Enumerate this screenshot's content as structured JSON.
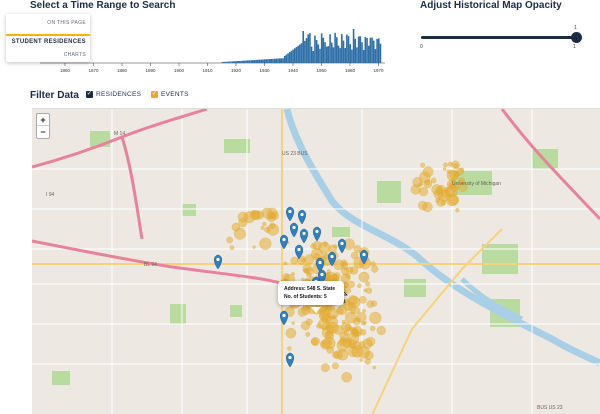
{
  "header": {
    "time_title": "Select a Time Range to Search",
    "opacity_title": "Adjust Historical Map Opacity"
  },
  "nav": {
    "items": [
      {
        "label": "ON THIS PAGE"
      },
      {
        "label": "STUDENT RESIDENCES"
      },
      {
        "label": "CHARTS"
      }
    ]
  },
  "histogram": {
    "x_ticks": [
      "1860",
      "1870",
      "1880",
      "1890",
      "1900",
      "1910",
      "1920",
      "1930",
      "1940",
      "1950",
      "1960",
      "1970"
    ]
  },
  "opacity_slider": {
    "min_label": "0",
    "max_label": "1",
    "value_label": "1",
    "value": 1
  },
  "filters": {
    "title": "Filter Data",
    "residences_label": "RESIDENCES",
    "events_label": "EVENTS",
    "residences_checked": true,
    "events_checked": true
  },
  "map": {
    "zoom_in": "+",
    "zoom_out": "−",
    "popup": {
      "address": "Address: 548 S. State",
      "students": "No. of Students: 5"
    },
    "labels": [
      "University of Michigan",
      "US 23 BUS",
      "BL 94",
      "I 94",
      "M 14",
      "BUS US 23"
    ]
  },
  "colors": {
    "navy": "#1d2b44",
    "gold": "#e0a93a",
    "pin": "#2f7fc1",
    "water": "#a9cfe6",
    "park": "#b9dba0"
  }
}
